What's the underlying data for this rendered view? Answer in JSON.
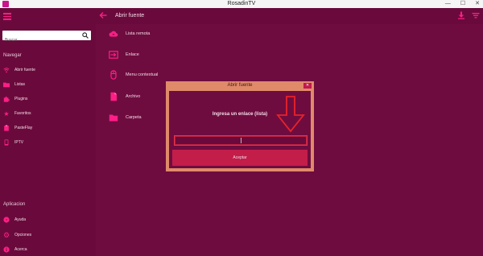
{
  "window": {
    "title": "RosadinTV",
    "controls": [
      "—",
      "☐",
      "✕"
    ]
  },
  "search": {
    "placeholder": "Buscar"
  },
  "sidebar": {
    "navigate_heading": "Navegar",
    "nav_items": [
      {
        "label": "Abrir fuente",
        "icon": "wifi-icon"
      },
      {
        "label": "Listas",
        "icon": "folder-icon"
      },
      {
        "label": "Plugins",
        "icon": "puzzle-icon"
      },
      {
        "label": "Favoritos",
        "icon": "star-icon"
      },
      {
        "label": "PasteFlay",
        "icon": "clipboard-icon"
      },
      {
        "label": "IPTV",
        "icon": "tv-icon"
      }
    ],
    "app_heading": "Aplicacion",
    "app_items": [
      {
        "label": "Ayuda",
        "icon": "help-icon"
      },
      {
        "label": "Opciones",
        "icon": "gear-icon"
      },
      {
        "label": "Acerca",
        "icon": "info-icon"
      }
    ]
  },
  "header": {
    "title": "Abrir fuente"
  },
  "sources": [
    {
      "label": "Lista remota",
      "icon": "cloud-download-icon"
    },
    {
      "label": "Enlace",
      "icon": "link-enter-icon"
    },
    {
      "label": "Menu contextual",
      "icon": "mouse-icon"
    },
    {
      "label": "Archivo",
      "icon": "file-icon"
    },
    {
      "label": "Carpeta",
      "icon": "folder-icon"
    }
  ],
  "dialog": {
    "title": "Abrir fuente",
    "close": "✕",
    "prompt": "Ingresa un enlace (lista)",
    "input_value": "",
    "accept_label": "Aceptar"
  },
  "colors": {
    "accent": "#ff1e86",
    "background": "#6f0c3f",
    "dialog_border": "#e08a6a",
    "button": "#c31d4a"
  }
}
